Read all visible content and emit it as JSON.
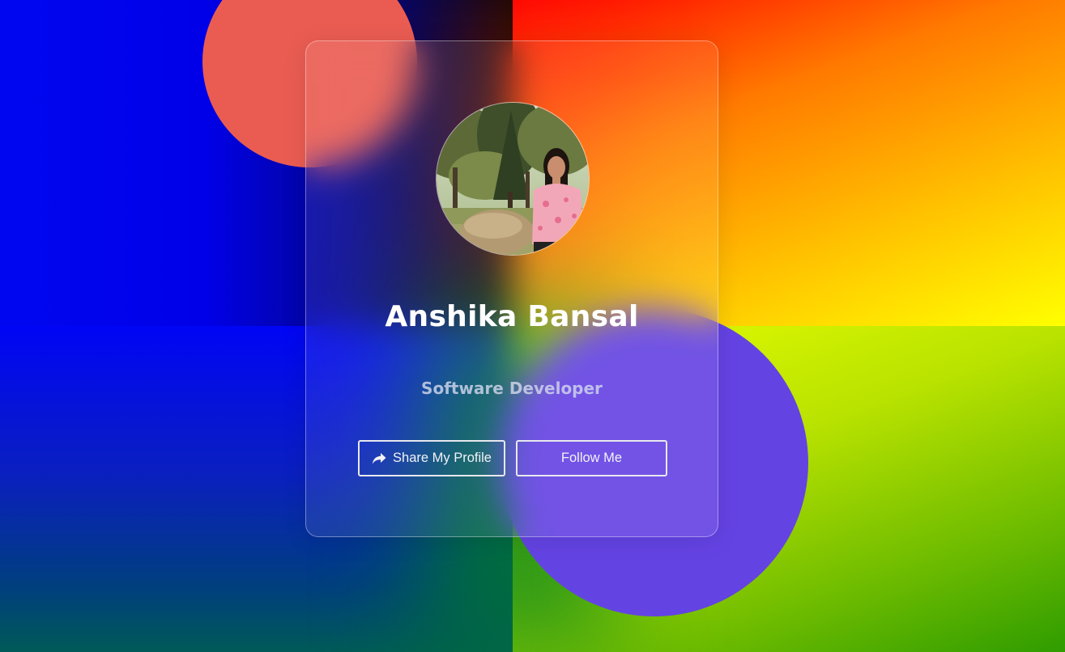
{
  "profile": {
    "name": "Anshika Bansal",
    "title": "Software Developer"
  },
  "actions": {
    "share_label": "Share My Profile",
    "share_icon": "share-arrow-icon",
    "follow_label": "Follow Me"
  },
  "colors": {
    "coral_circle": "#ea5c52",
    "purple_circle": "#6443e3",
    "text_primary": "#ffffff"
  }
}
